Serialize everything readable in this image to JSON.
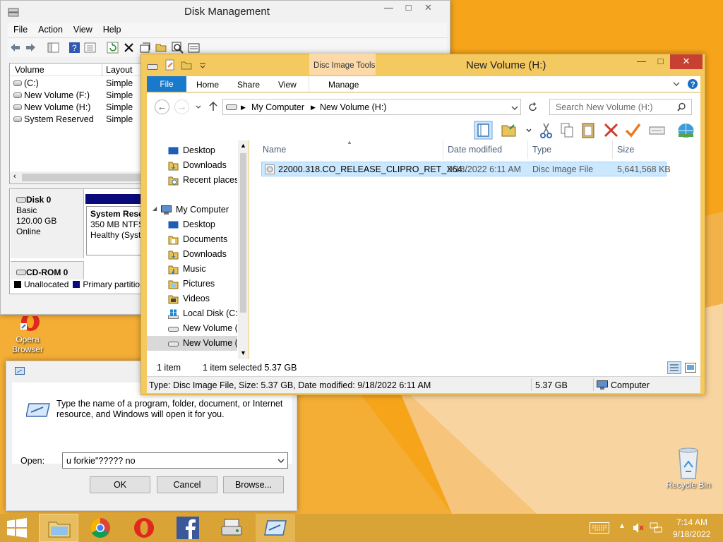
{
  "desktop": {
    "opera_label_line1": "Opera",
    "opera_label_line2": "Browser",
    "recycle_bin_label": "Recycle Bin"
  },
  "disk_management": {
    "title": "Disk Management",
    "menu": [
      "File",
      "Action",
      "View",
      "Help"
    ],
    "volume_columns": [
      "Volume",
      "Layout"
    ],
    "volumes": [
      {
        "name": "(C:)",
        "layout": "Simple"
      },
      {
        "name": "New Volume (F:)",
        "layout": "Simple"
      },
      {
        "name": "New Volume (H:)",
        "layout": "Simple"
      },
      {
        "name": "System Reserved",
        "layout": "Simple"
      }
    ],
    "disk0": {
      "name": "Disk 0",
      "type": "Basic",
      "size": "120.00 GB",
      "status": "Online"
    },
    "partition": {
      "name": "System Rese",
      "size": "350 MB NTFS",
      "health": "Healthy (Syst"
    },
    "cdrom": {
      "name": "CD-ROM 0"
    },
    "legend": [
      "Unallocated",
      "Primary partitio"
    ],
    "legend_colors": [
      "#000000",
      "#0a0a7a"
    ]
  },
  "explorer": {
    "title": "New Volume (H:)",
    "context_tab_header": "Disc Image Tools",
    "tabs": {
      "file": "File",
      "home": "Home",
      "share": "Share",
      "view": "View",
      "manage": "Manage"
    },
    "address": {
      "seg1": "My Computer",
      "seg2": "New Volume (H:)"
    },
    "search_placeholder": "Search New Volume (H:)",
    "nav": {
      "favorites": [
        "Desktop",
        "Downloads",
        "Recent places"
      ],
      "computer": "My Computer",
      "computer_items": [
        "Desktop",
        "Documents",
        "Downloads",
        "Music",
        "Pictures",
        "Videos",
        "Local Disk (C:)",
        "New Volume (I",
        "New Volume (I"
      ]
    },
    "columns": [
      "Name",
      "Date modified",
      "Type",
      "Size"
    ],
    "files": [
      {
        "name": "22000.318.CO_RELEASE_CLIPRO_RET_X64...",
        "modified": "9/18/2022 6:11 AM",
        "type": "Disc Image File",
        "size": "5,641,568 KB"
      }
    ],
    "status": {
      "items": "1 item",
      "selected": "1 item selected  5.37 GB"
    },
    "details": {
      "info": "Type: Disc Image File, Size: 5.37 GB, Date modified: 9/18/2022 6:11 AM",
      "size": "5.37 GB",
      "location": "Computer"
    }
  },
  "run": {
    "prompt": "Type the name of a program, folder, document, or Internet resource, and Windows will open it for you.",
    "open_label": "Open:",
    "value": "u forkie\"????? no",
    "ok": "OK",
    "cancel": "Cancel",
    "browse": "Browse..."
  },
  "tray": {
    "time": "7:14 AM",
    "date": "9/18/2022"
  },
  "colors": {
    "desktop": "#f6a51b",
    "taskbar": "#d9a335",
    "accent": "#1979ca",
    "selection": "#cce8ff"
  }
}
